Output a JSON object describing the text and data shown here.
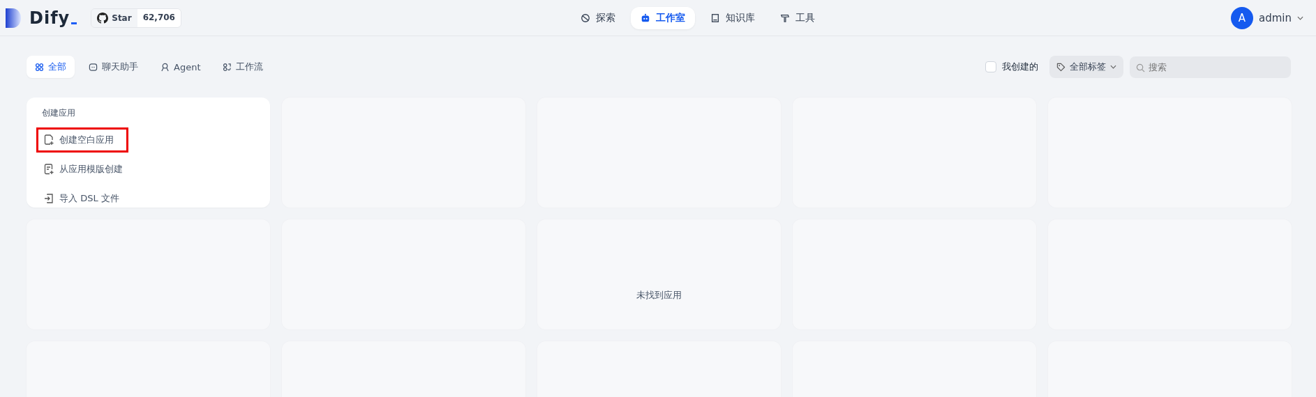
{
  "header": {
    "logo": "Dify",
    "github": {
      "label": "Star",
      "count": "62,706"
    },
    "nav": [
      {
        "label": "探索",
        "selected": false
      },
      {
        "label": "工作室",
        "selected": true
      },
      {
        "label": "知识库",
        "selected": false
      },
      {
        "label": "工具",
        "selected": false
      }
    ],
    "user": {
      "initial": "A",
      "name": "admin"
    }
  },
  "filters": {
    "tabs": [
      {
        "label": "全部",
        "selected": true
      },
      {
        "label": "聊天助手",
        "selected": false
      },
      {
        "label": "Agent",
        "selected": false
      },
      {
        "label": "工作流",
        "selected": false
      }
    ],
    "created_by_me": {
      "label": "我创建的",
      "checked": false
    },
    "tag_select": {
      "label": "全部标签"
    },
    "search": {
      "placeholder": "搜索"
    }
  },
  "create_card": {
    "title": "创建应用",
    "items": [
      {
        "label": "创建空白应用",
        "highlighted": true
      },
      {
        "label": "从应用模版创建",
        "highlighted": false
      },
      {
        "label": "导入 DSL 文件",
        "highlighted": false
      }
    ]
  },
  "empty_message": "未找到应用"
}
